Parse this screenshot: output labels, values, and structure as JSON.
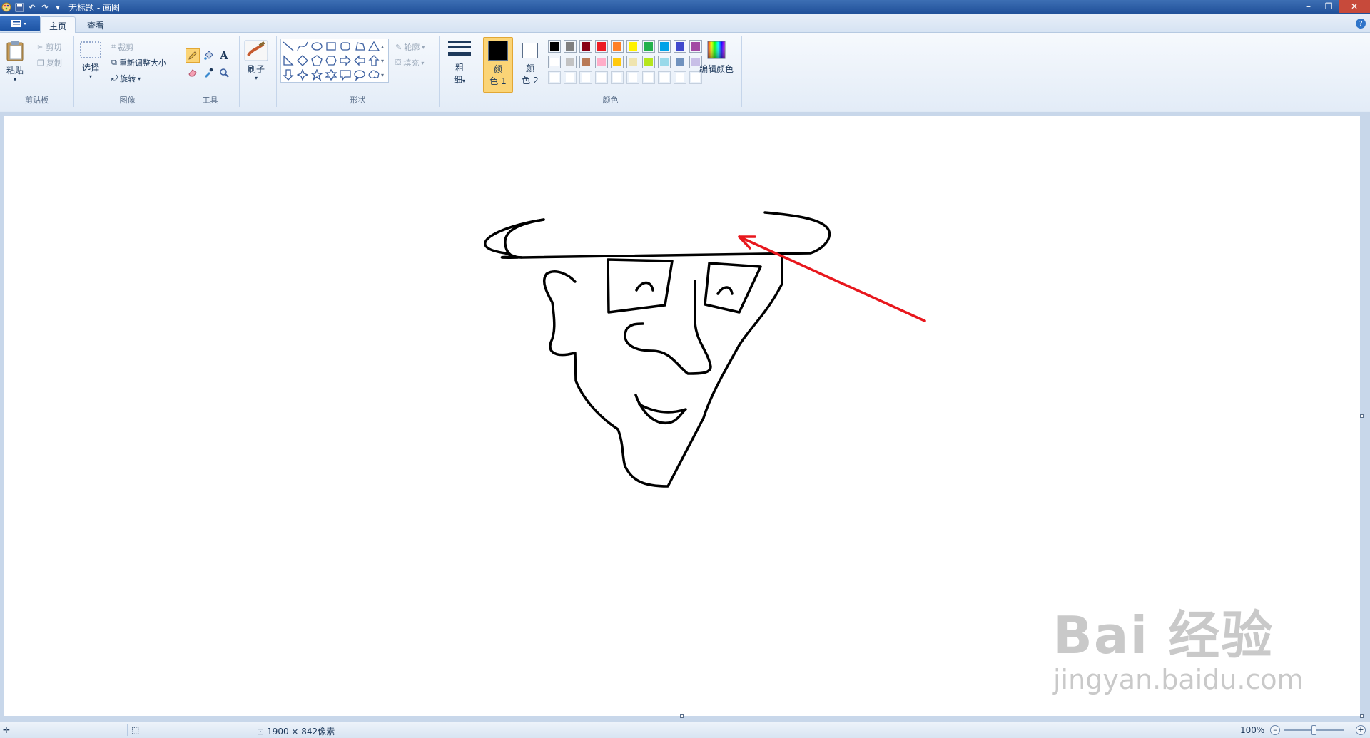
{
  "window": {
    "title": "无标题 - 画图",
    "controls": [
      "minimize-icon",
      "restore-icon",
      "close-icon"
    ]
  },
  "quick_access": {
    "icons": [
      "paint-app-icon",
      "save-icon",
      "undo-icon",
      "redo-icon",
      "customize-dropdown-icon"
    ]
  },
  "tabs": [
    {
      "label": "主页",
      "active": true
    },
    {
      "label": "查看",
      "active": false
    }
  ],
  "ribbon": {
    "clipboard": {
      "label": "剪贴板",
      "paste": "粘贴",
      "cut": "剪切",
      "copy": "复制"
    },
    "image": {
      "label": "图像",
      "select": "选择",
      "crop": "裁剪",
      "resize": "重新调整大小",
      "rotate": "旋转"
    },
    "tools": {
      "label": "工具",
      "items": [
        "pencil-icon",
        "fill-icon",
        "text-icon",
        "eraser-icon",
        "color-picker-icon",
        "magnifier-icon"
      ],
      "selected": "pencil-icon"
    },
    "brushes": {
      "label": "刷子"
    },
    "shapes": {
      "label": "形状",
      "outline": "轮廓",
      "fill": "填充"
    },
    "size": {
      "label_top": "粗",
      "label_bottom": "细"
    },
    "colors": {
      "label": "颜色",
      "color1_top": "颜",
      "color1_bottom": "色 1",
      "color2_top": "颜",
      "color2_bottom": "色 2",
      "color1_value": "#000000",
      "color2_value": "#ffffff",
      "edit": "编辑颜色",
      "palette_row1": [
        "#000000",
        "#7f7f7f",
        "#880015",
        "#ed1c24",
        "#ff7f27",
        "#fff200",
        "#22b14c",
        "#00a2e8",
        "#3f48cc",
        "#a349a4"
      ],
      "palette_row2": [
        "#ffffff",
        "#c3c3c3",
        "#b97a57",
        "#ffaec9",
        "#ffc90e",
        "#efe4b0",
        "#b5e61d",
        "#99d9ea",
        "#7092be",
        "#c8bfe7"
      ],
      "palette_row3": [
        "#ffffff",
        "#ffffff",
        "#ffffff",
        "#ffffff",
        "#ffffff",
        "#ffffff",
        "#ffffff",
        "#ffffff",
        "#ffffff",
        "#ffffff"
      ]
    }
  },
  "canvas": {
    "drawing_color": "#000000",
    "arrow_color": "#e8171d"
  },
  "watermark": {
    "main": "Bai 经验",
    "sub": "jingyan.baidu.com"
  },
  "status": {
    "dimensions": "1900 × 842像素",
    "zoom": "100%"
  }
}
